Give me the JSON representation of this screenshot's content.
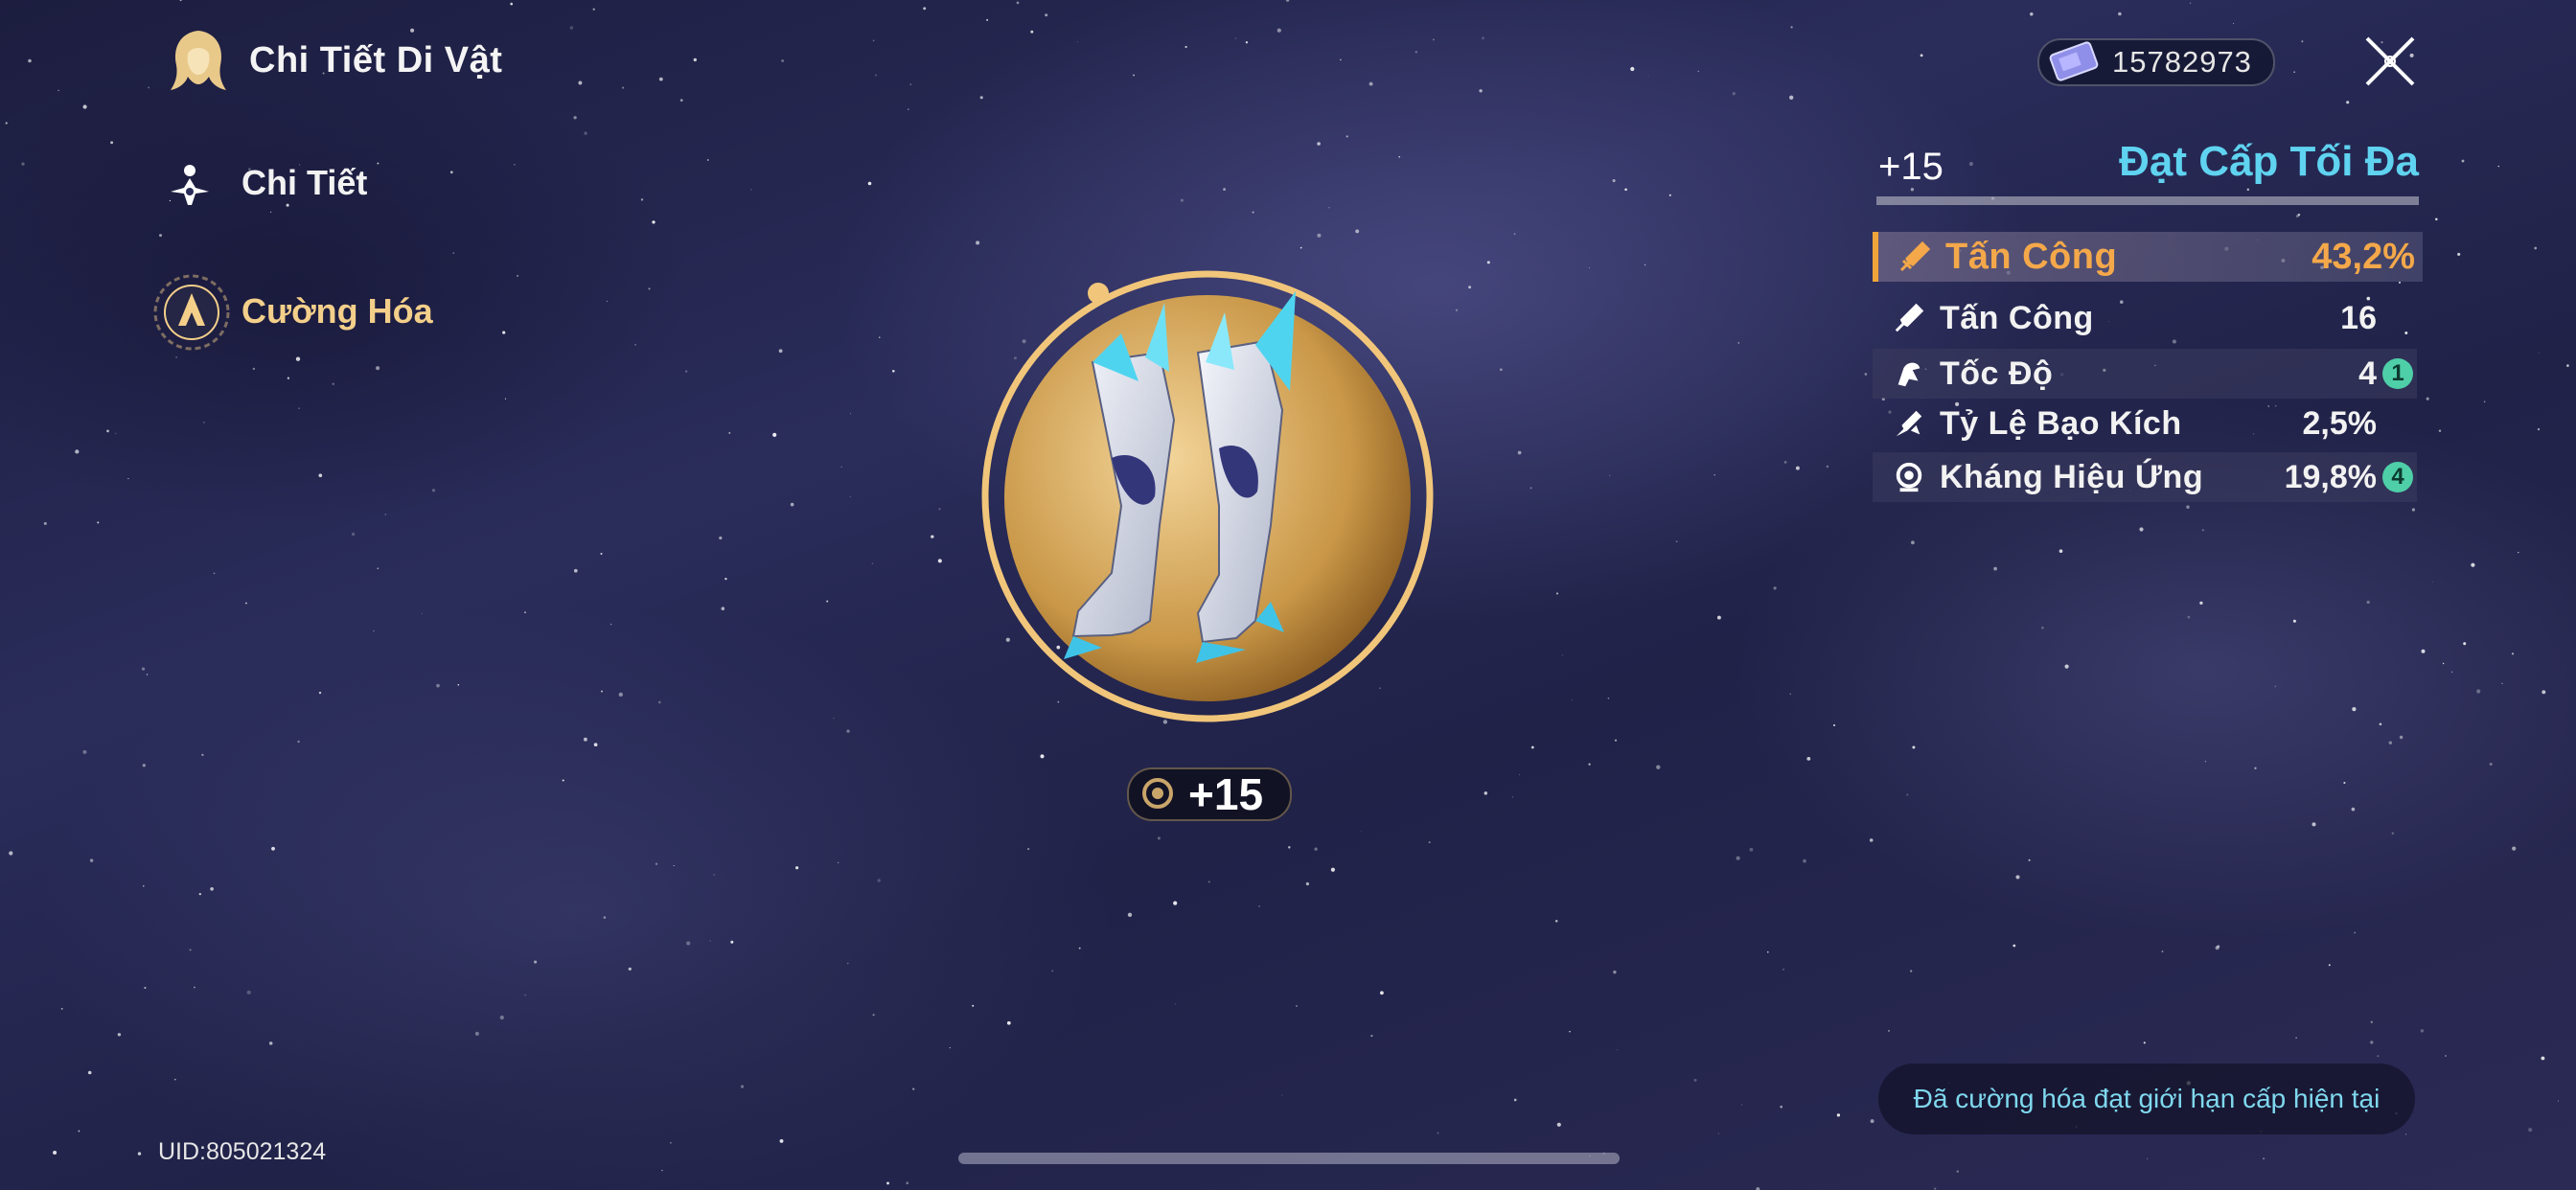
{
  "header": {
    "title": "Chi Tiết Di Vật"
  },
  "nav": {
    "items": [
      {
        "label": "Chi Tiết",
        "icon": "character-icon"
      },
      {
        "label": "Cường Hóa",
        "icon": "enhance-icon"
      }
    ]
  },
  "currency": {
    "value": "15782973",
    "icon": "pass-ticket-icon"
  },
  "relic": {
    "name_icon": "relic-boots",
    "level": "+15"
  },
  "panel": {
    "level": "+15",
    "status": "Đạt Cấp Tối Đa",
    "main_stat": {
      "label": "Tấn Công",
      "value": "43,2%"
    },
    "sub_stats": [
      {
        "label": "Tấn Công",
        "value": "16",
        "badge": ""
      },
      {
        "label": "Tốc Độ",
        "value": "4",
        "badge": "1"
      },
      {
        "label": "Tỷ Lệ Bạo Kích",
        "value": "2,5%",
        "badge": ""
      },
      {
        "label": "Kháng Hiệu Ứng",
        "value": "19,8%",
        "badge": "4"
      }
    ]
  },
  "notice": "Đã cường hóa đạt giới hạn cấp hiện tại",
  "uid": "UID:805021324",
  "colors": {
    "accent_gold": "#f4a84a",
    "accent_cyan": "#5fd3f0",
    "badge_green": "#4ecfa8"
  }
}
